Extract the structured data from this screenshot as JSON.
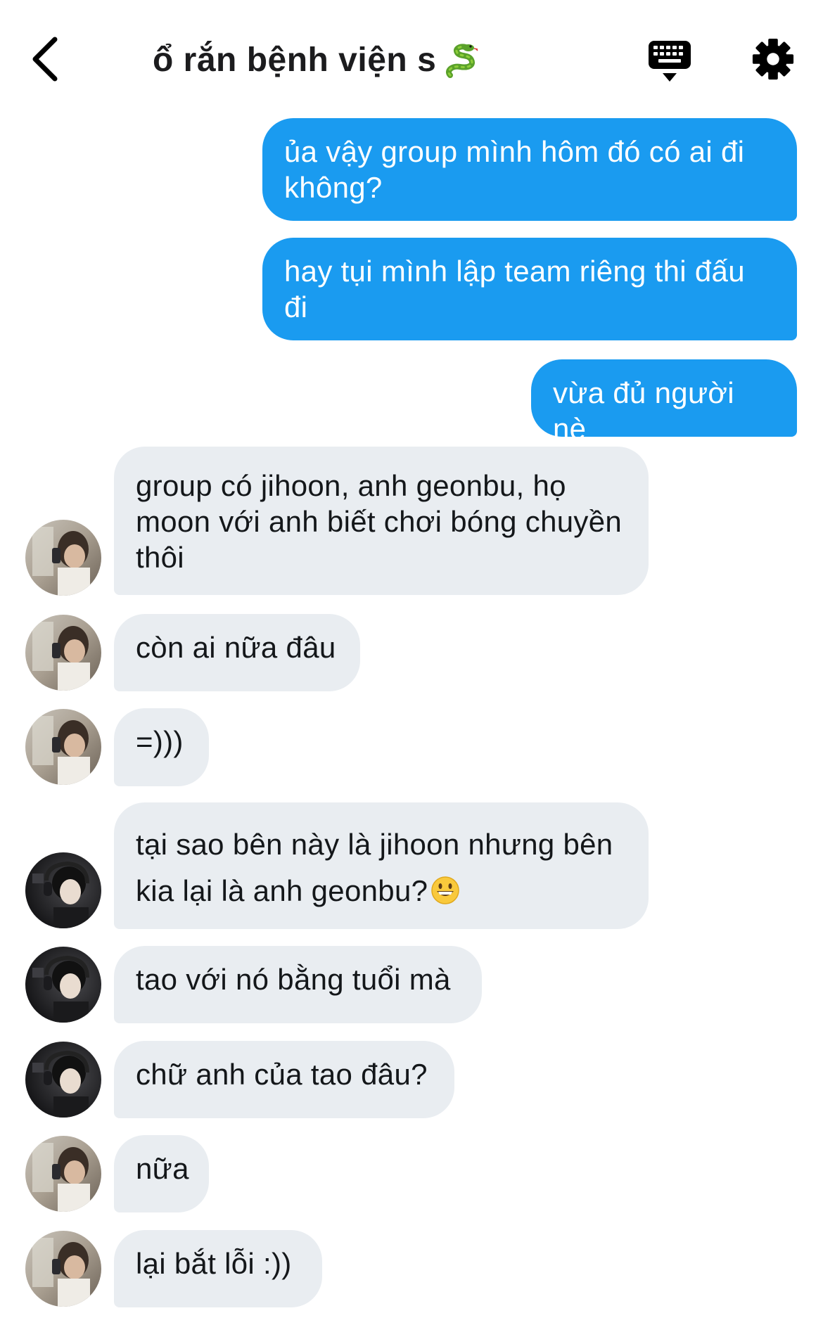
{
  "header": {
    "title": "ổ rắn bệnh viện s",
    "title_emoji": "snake-emoji"
  },
  "icons": {
    "back": "chevron-left-icon",
    "keyboard": "keyboard-icon",
    "settings": "gear-icon"
  },
  "colors": {
    "outgoing_bubble": "#1a9bf0",
    "incoming_bubble": "#e9edf1",
    "background": "#ffffff"
  },
  "messages": [
    {
      "side": "out",
      "text": "ủa vậy group mình hôm đó có ai đi không?"
    },
    {
      "side": "out",
      "text": "hay tụi mình lập team riêng thi đấu đi"
    },
    {
      "side": "out",
      "text": "vừa đủ người nè"
    },
    {
      "side": "in",
      "avatar": "light",
      "text": "group có jihoon, anh geonbu, họ moon với anh biết chơi bóng chuyền thôi"
    },
    {
      "side": "in",
      "avatar": "light",
      "text": "còn ai nữa đâu"
    },
    {
      "side": "in",
      "avatar": "light",
      "text": "=)))"
    },
    {
      "side": "in",
      "avatar": "dark",
      "text": "tại sao bên này là jihoon nhưng bên kia lại là anh geonbu?",
      "emoji": "grinning-face-emoji"
    },
    {
      "side": "in",
      "avatar": "dark",
      "text": "tao với nó bằng tuổi mà"
    },
    {
      "side": "in",
      "avatar": "dark",
      "text": "chữ anh của tao đâu?"
    },
    {
      "side": "in",
      "avatar": "light",
      "text": "nữa"
    },
    {
      "side": "in",
      "avatar": "light",
      "text": "lại bắt lỗi :))"
    }
  ]
}
